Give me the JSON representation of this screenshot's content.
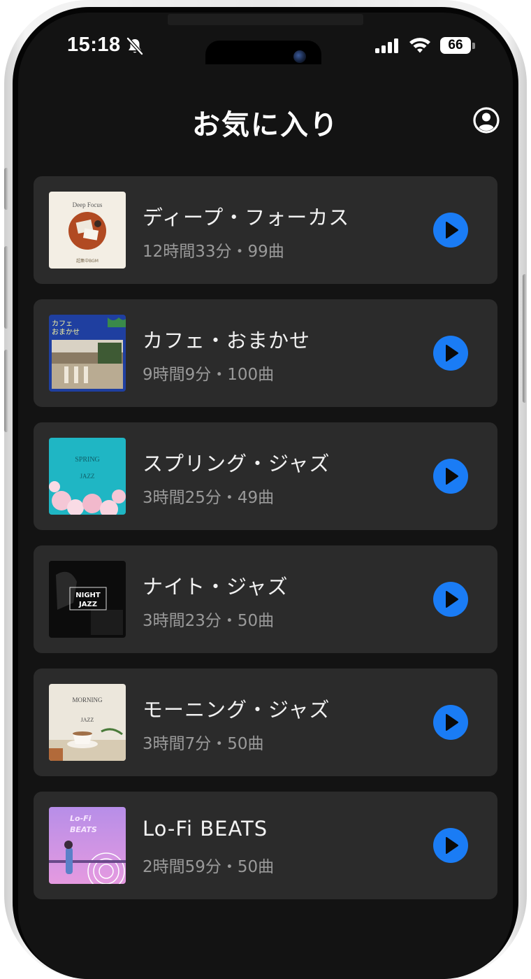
{
  "status_bar": {
    "time": "15:18",
    "battery": "66",
    "icons": [
      "bell-slash-icon",
      "cellular-signal-icon",
      "wifi-icon",
      "battery-icon"
    ]
  },
  "header": {
    "title": "お気に入り",
    "profile_icon": "person-circle-icon"
  },
  "playlists": [
    {
      "title": "ディープ・フォーカス",
      "meta": "12時間33分・99曲",
      "art_text": [
        "Deep Focus",
        "超集中BGM"
      ],
      "art_icon": "deep-focus-cover-icon"
    },
    {
      "title": "カフェ・おまかせ",
      "meta": "9時間9分・100曲",
      "art_text": [
        "カフェ",
        "おまかせ"
      ],
      "art_icon": "cafe-cover-icon"
    },
    {
      "title": "スプリング・ジャズ",
      "meta": "3時間25分・49曲",
      "art_text": [
        "SPRING",
        "JAZZ"
      ],
      "art_icon": "spring-jazz-cover-icon"
    },
    {
      "title": "ナイト・ジャズ",
      "meta": "3時間23分・50曲",
      "art_text": [
        "NIGHT",
        "JAZZ"
      ],
      "art_icon": "night-jazz-cover-icon"
    },
    {
      "title": "モーニング・ジャズ",
      "meta": "3時間7分・50曲",
      "art_text": [
        "MORNING",
        "JAZZ"
      ],
      "art_icon": "morning-jazz-cover-icon"
    },
    {
      "title": "Lo-Fi BEATS",
      "meta": "2時間59分・50曲",
      "art_text": [
        "Lo-Fi",
        "BEATS"
      ],
      "art_icon": "lofi-beats-cover-icon"
    }
  ],
  "colors": {
    "background": "#131313",
    "card": "#2b2b2b",
    "accent": "#1a7cf5",
    "text_primary": "#f2f2f2",
    "text_secondary": "#9a9a9a"
  }
}
